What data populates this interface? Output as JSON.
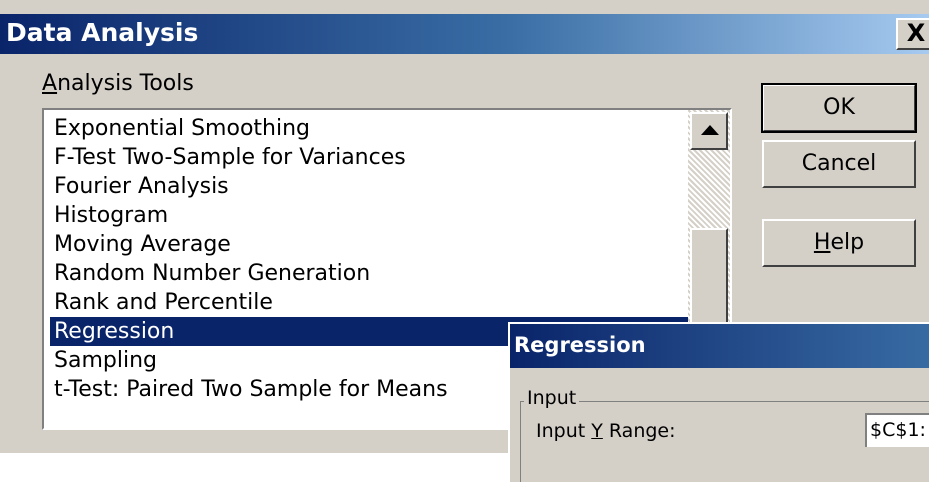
{
  "dialog": {
    "title": "Data Analysis",
    "close_glyph": "X",
    "list_label_first": "A",
    "list_label_rest": "nalysis Tools",
    "tools": [
      "Exponential Smoothing",
      "F-Test Two-Sample for Variances",
      "Fourier Analysis",
      "Histogram",
      "Moving Average",
      "Random Number Generation",
      "Rank and Percentile",
      "Regression",
      "Sampling",
      "t-Test: Paired Two Sample for Means"
    ],
    "selected_tool": "Regression",
    "buttons": {
      "ok": "OK",
      "cancel": "Cancel",
      "help_first": "H",
      "help_rest": "elp"
    }
  },
  "regression": {
    "title": "Regression",
    "input_group": "Input",
    "y_range_pre": "Input ",
    "y_range_key": "Y",
    "y_range_post": " Range:",
    "y_range_value": "$C$1:"
  },
  "colors": {
    "title_active": "#0a246a",
    "selection": "#0a246a",
    "face": "#d4d0c8"
  }
}
